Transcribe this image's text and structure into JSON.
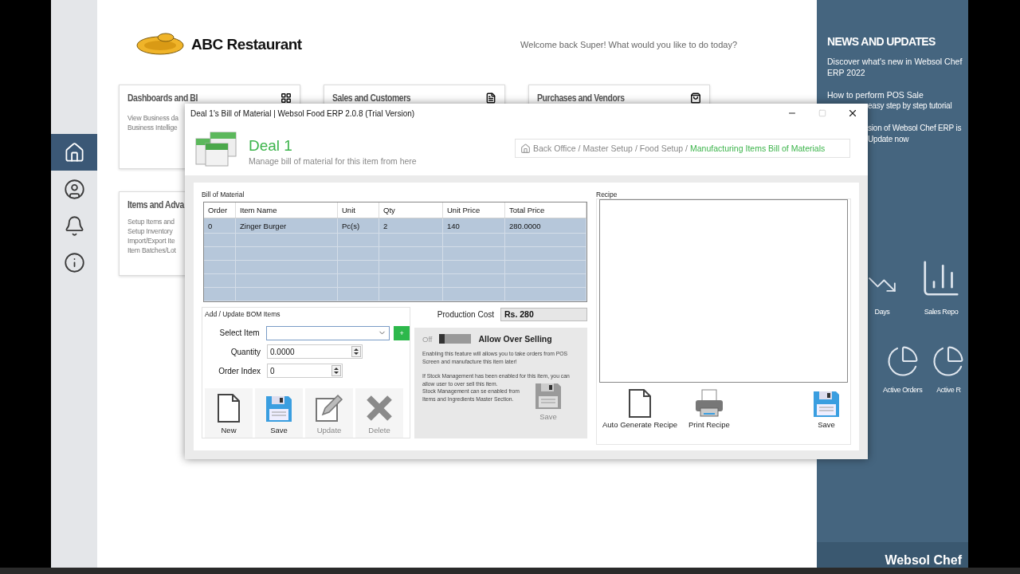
{
  "sidebar": {
    "items": [
      {
        "selected": true
      },
      {
        "selected": false
      },
      {
        "selected": false
      },
      {
        "selected": false
      }
    ]
  },
  "header": {
    "brand": "ABC Restaurant",
    "welcome": "Welcome back Super! What would you like to do today?"
  },
  "cards": [
    {
      "title": "Dashboards and BI",
      "lines": [
        "View Business da",
        "Business Intellige"
      ]
    },
    {
      "title": "Sales and Customers"
    },
    {
      "title": "Purchases and Vendors"
    },
    {
      "title": "Items and Adva",
      "lines": [
        "Setup Items and",
        "Setup Inventory",
        "Import/Export Ite",
        "Item Batches/Lot"
      ]
    }
  ],
  "news": {
    "title": "NEWS AND UPDATES",
    "items": [
      "Discover what's new in Websol Chef ERP 2022",
      "How to perform POS Sale"
    ],
    "partial_items": [
      "easy step by step tutorial",
      "sion of Websol Chef ERP is",
      "Update now"
    ]
  },
  "shortcuts": [
    {
      "label": "Days"
    },
    {
      "label": "Sales Repo"
    },
    {
      "label": "Active Orders"
    },
    {
      "label": "Active R"
    }
  ],
  "footer_logo": "Websol Chef",
  "dialog": {
    "title": "Deal 1's Bill of Material | Websol Food ERP 2.0.8 (Trial Version)",
    "maximize_disabled": true,
    "heading": "Deal 1",
    "subtitle": "Manage bill of material for this item from here",
    "breadcrumb": {
      "separator": "/",
      "items": [
        {
          "label": "Back Office",
          "current": false
        },
        {
          "label": "Master Setup",
          "current": false
        },
        {
          "label": "Food Setup",
          "current": false
        },
        {
          "label": "Manufacturing Items Bill of Materials",
          "current": true
        }
      ]
    },
    "bom": {
      "title": "Bill of Material",
      "columns": [
        "Order",
        "Item Name",
        "Unit",
        "Qty",
        "Unit Price",
        "Total Price"
      ],
      "rows": [
        [
          "0",
          "Zinger Burger",
          "Pc(s)",
          "2",
          "140",
          "280.0000"
        ]
      ]
    },
    "form": {
      "title": "Add / Update BOM Items",
      "add_button": "+",
      "fields": [
        {
          "kind": "dropdown",
          "label": "Select Item"
        },
        {
          "kind": "spinner",
          "label": "Quantity",
          "value": "0.0000"
        },
        {
          "kind": "spinner",
          "label": "Order Index",
          "value": "0"
        }
      ],
      "buttons": [
        {
          "kind": "new",
          "label": "New",
          "disabled": false
        },
        {
          "kind": "save",
          "label": "Save",
          "disabled": false
        },
        {
          "kind": "update",
          "label": "Update",
          "disabled": true
        },
        {
          "kind": "delete",
          "label": "Delete",
          "disabled": true
        }
      ]
    },
    "production_cost": {
      "label": "Production Cost",
      "value": "Rs. 280"
    },
    "over_selling": {
      "state_label": "Off",
      "on": false,
      "title": "Allow Over Selling",
      "description": "Enabling this feature will allows you to take orders from POS Screen and manufacture this item later!",
      "notes": [
        "If Stock Management has been enabled for this item, you can allow user to over sell this item.",
        "Stock Management can se enabled from Items and Ingredients Master Section."
      ],
      "save": {
        "label": "Save",
        "disabled": true
      }
    },
    "recipe": {
      "title": "Recipe",
      "buttons": [
        {
          "kind": "new",
          "label": "Auto Generate Recipe",
          "disabled": false
        },
        {
          "kind": "print",
          "label": "Print Recipe",
          "disabled": false
        },
        {
          "kind": "save",
          "label": "Save",
          "disabled": false
        }
      ]
    }
  }
}
